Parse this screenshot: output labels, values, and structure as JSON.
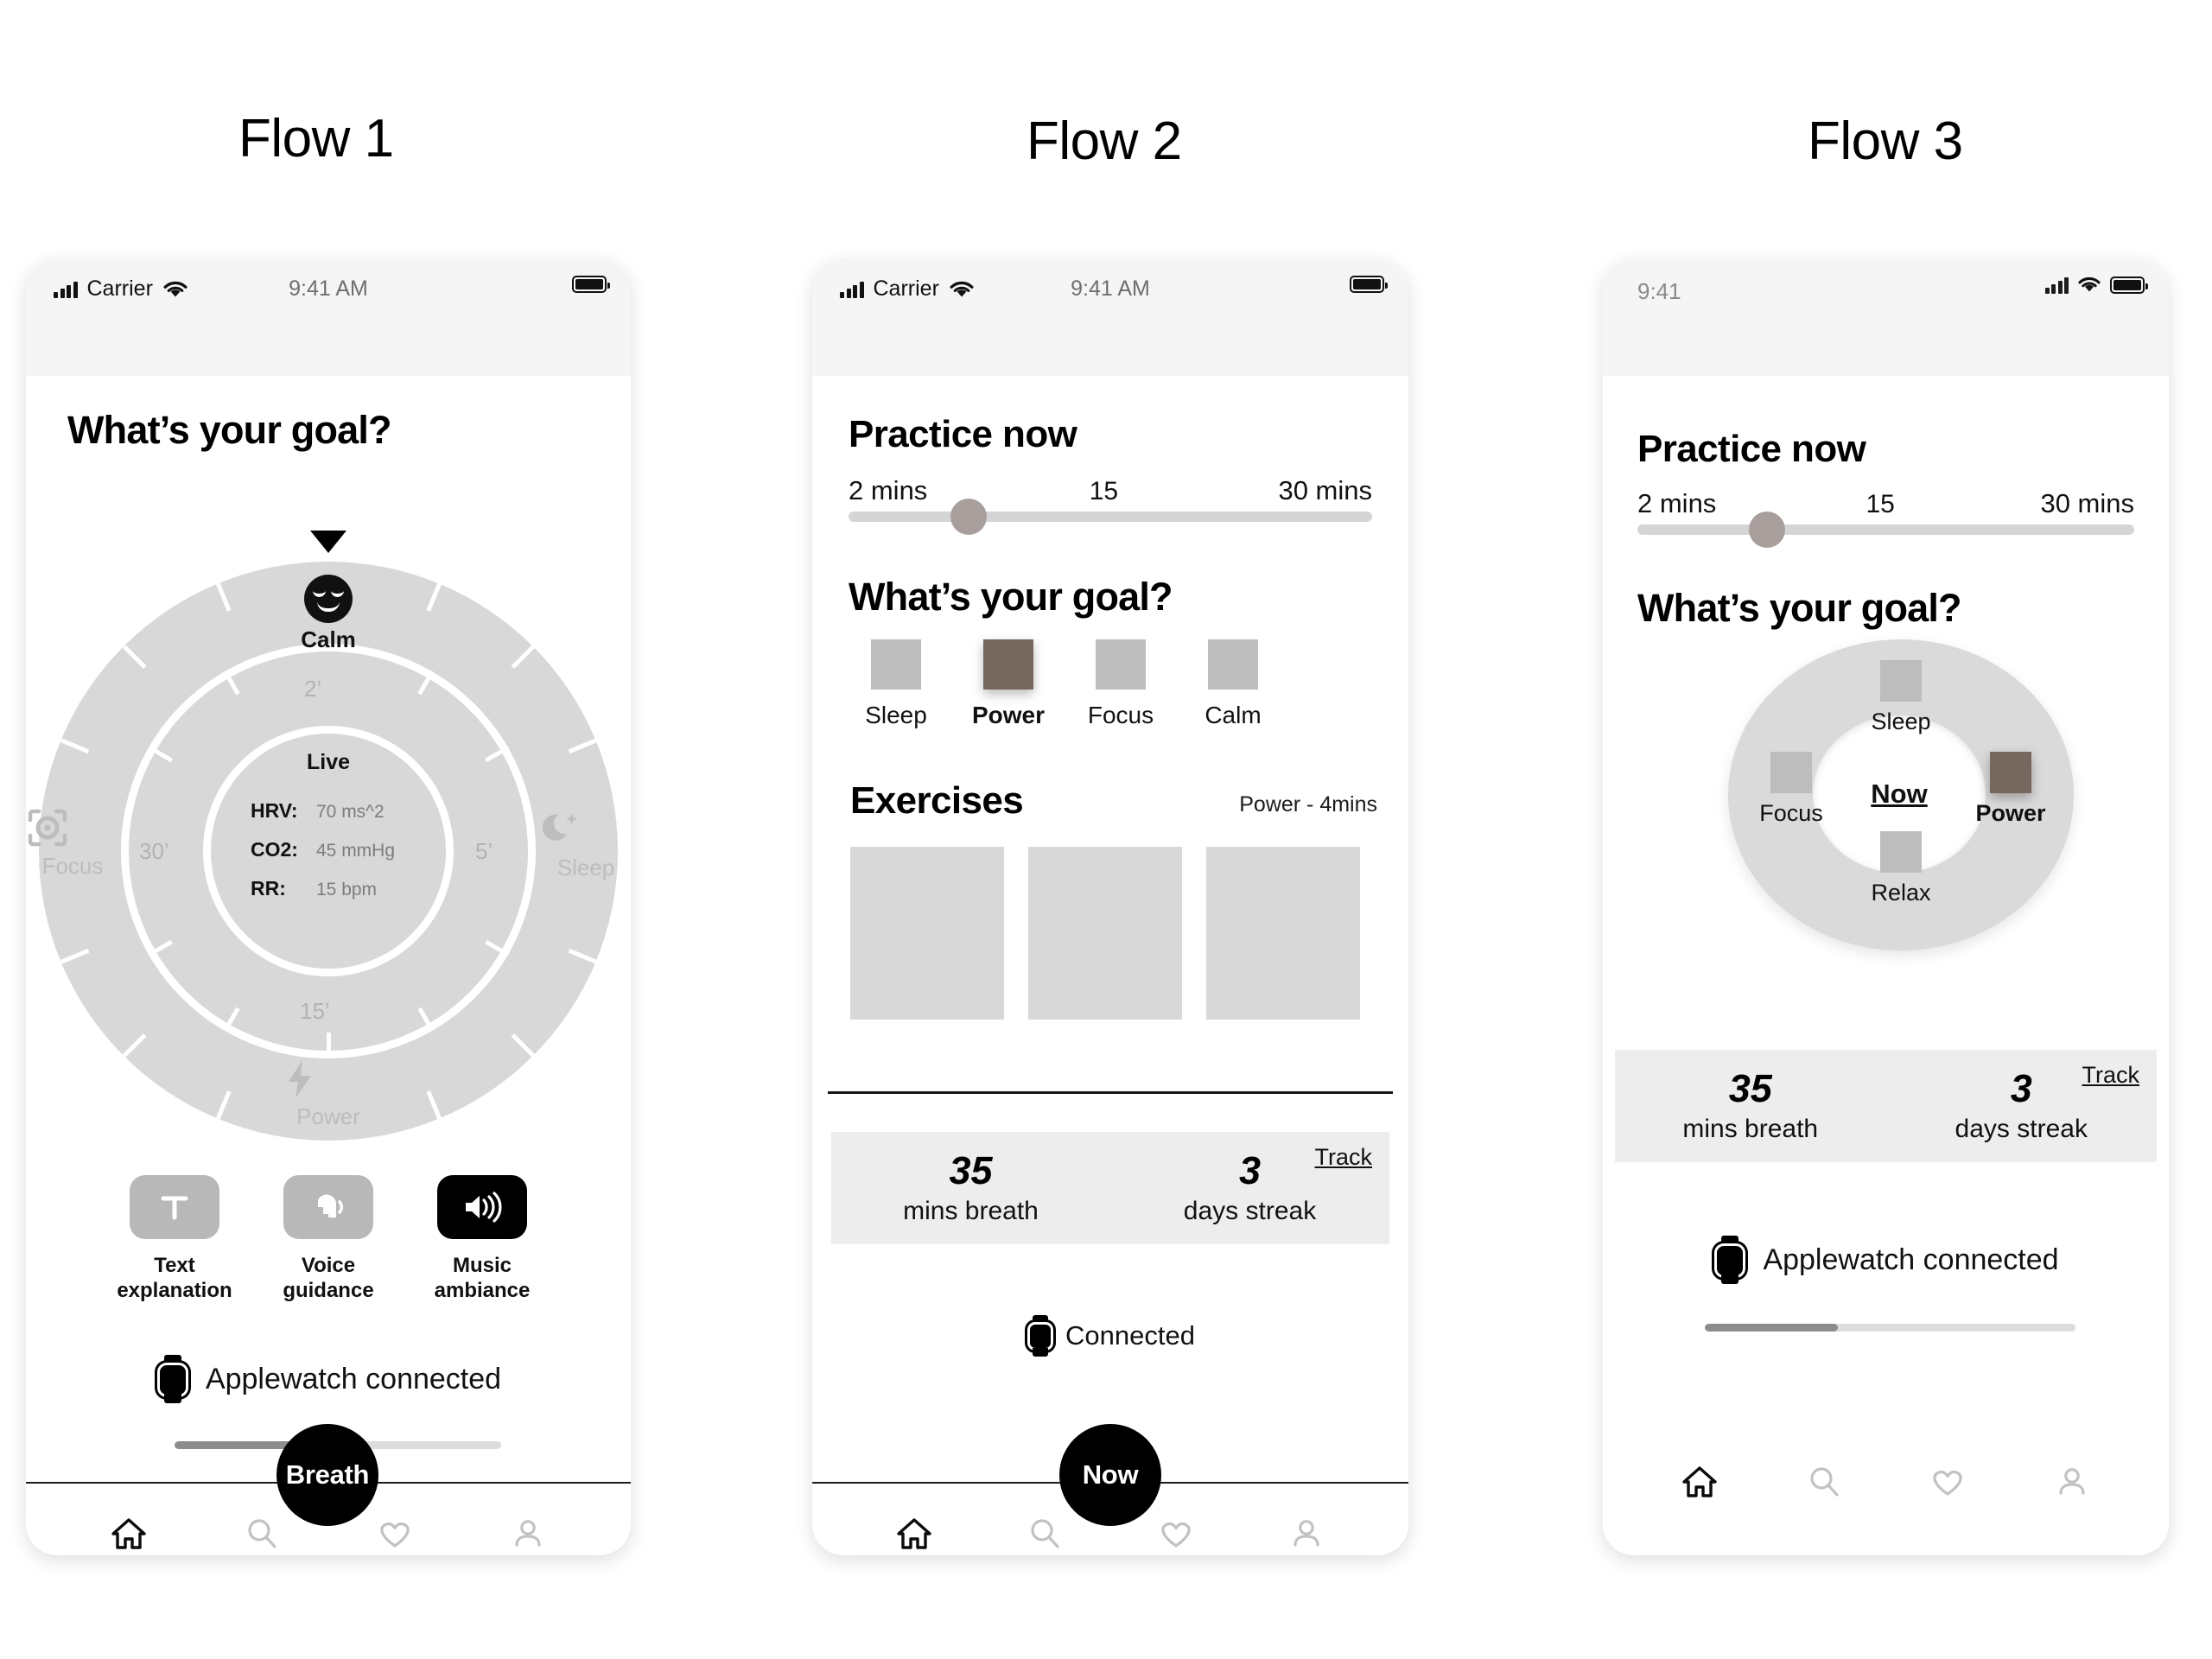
{
  "columns": [
    {
      "title": "Flow 1"
    },
    {
      "title": "Flow 2"
    },
    {
      "title": "Flow 3"
    }
  ],
  "flow1": {
    "status_bar": {
      "carrier": "Carrier",
      "time": "9:41 AM"
    },
    "heading": "What’s your goal?",
    "dial": {
      "nodes": [
        {
          "label": "Calm",
          "icon": "calm-face-icon",
          "selected": true
        },
        {
          "label": "Sleep",
          "icon": "moon-star-icon",
          "selected": false
        },
        {
          "label": "Power",
          "icon": "lightning-bolt-icon",
          "selected": false
        },
        {
          "label": "Focus",
          "icon": "focus-target-icon",
          "selected": false
        }
      ],
      "time_marks": [
        "2’",
        "5’",
        "15’",
        "30’"
      ],
      "live": {
        "title": "Live",
        "metrics": [
          {
            "key": "HRV:",
            "value": "70 ms^2"
          },
          {
            "key": "CO2:",
            "value": "45 mmHg"
          },
          {
            "key": "RR:",
            "value": "15 bpm"
          }
        ]
      }
    },
    "modes": [
      {
        "label": "Text\nexplanation",
        "icon": "text-t-icon",
        "active": false
      },
      {
        "label": "Voice\nguidance",
        "icon": "speaking-head-icon",
        "active": false
      },
      {
        "label": "Music\nambiance",
        "icon": "speaker-waves-icon",
        "active": true
      }
    ],
    "watch": {
      "text": "Applewatch connected",
      "icon": "applewatch-icon"
    },
    "progress_percent": 36,
    "fab_label": "Breath",
    "nav": [
      {
        "name": "home",
        "active": true
      },
      {
        "name": "search",
        "active": false
      },
      {
        "name": "heart",
        "active": false
      },
      {
        "name": "profile",
        "active": false
      }
    ]
  },
  "flow2": {
    "status_bar": {
      "carrier": "Carrier",
      "time": "9:41 AM"
    },
    "heading": "Practice now",
    "slider": {
      "min_label": "2 mins",
      "value_label": "15",
      "max_label": "30 mins",
      "value_percent": 23
    },
    "goal_heading": "What’s your goal?",
    "goals": [
      {
        "label": "Sleep",
        "selected": false
      },
      {
        "label": "Power",
        "selected": true
      },
      {
        "label": "Focus",
        "selected": false
      },
      {
        "label": "Calm",
        "selected": false
      }
    ],
    "exercises": {
      "heading": "Exercises",
      "meta": "Power - 4mins",
      "cards": [
        "",
        "",
        ""
      ]
    },
    "stats": {
      "track_label": "Track",
      "items": [
        {
          "number": "35",
          "label": "mins breath"
        },
        {
          "number": "3",
          "label": "days streak"
        }
      ]
    },
    "watch": {
      "text": "Connected",
      "icon": "applewatch-icon"
    },
    "fab_label": "Now",
    "nav": [
      {
        "name": "home",
        "active": true
      },
      {
        "name": "search",
        "active": false
      },
      {
        "name": "heart",
        "active": false
      },
      {
        "name": "profile",
        "active": false
      }
    ]
  },
  "flow3": {
    "status_bar": {
      "time": "9:41"
    },
    "heading": "Practice now",
    "slider": {
      "min_label": "2 mins",
      "value_label": "15",
      "max_label": "30 mins",
      "value_percent": 26
    },
    "goal_heading": "What’s your goal?",
    "donut": {
      "center_label": "Now",
      "nodes": [
        {
          "label": "Sleep",
          "position": "top",
          "selected": false
        },
        {
          "label": "Power",
          "position": "right",
          "selected": true
        },
        {
          "label": "Relax",
          "position": "bottom",
          "selected": false
        },
        {
          "label": "Focus",
          "position": "left",
          "selected": false
        }
      ]
    },
    "stats": {
      "track_label": "Track",
      "items": [
        {
          "number": "35",
          "label": "mins breath"
        },
        {
          "number": "3",
          "label": "days streak"
        }
      ]
    },
    "watch": {
      "text": "Applewatch connected",
      "icon": "applewatch-icon"
    },
    "progress_percent": 36,
    "nav": [
      {
        "name": "home",
        "active": true
      },
      {
        "name": "search",
        "active": false
      },
      {
        "name": "heart",
        "active": false
      },
      {
        "name": "profile",
        "active": false
      }
    ]
  },
  "theme": {
    "selected_goal_color": "#76685f",
    "ring_gray": "#d8d8d8",
    "tile_gray": "#b8b8b8",
    "accent_black": "#000000",
    "stats_bg": "#ededed",
    "slider_thumb": "#a89e9c"
  }
}
